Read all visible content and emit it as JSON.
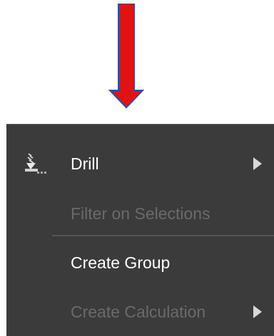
{
  "callout": {
    "icon": "down-arrow-icon",
    "color": "#e31212",
    "outline": "#2f4f9a"
  },
  "menu": {
    "background": "#3b3b3b",
    "items": [
      {
        "label": "Drill",
        "enabled": true,
        "icon": "drill-icon",
        "has_submenu": true
      },
      {
        "label": "Filter on Selections",
        "enabled": false,
        "has_submenu": false
      },
      {
        "label": "Create Group",
        "enabled": true,
        "has_submenu": false
      },
      {
        "label": "Create Calculation",
        "enabled": false,
        "has_submenu": true
      }
    ]
  }
}
